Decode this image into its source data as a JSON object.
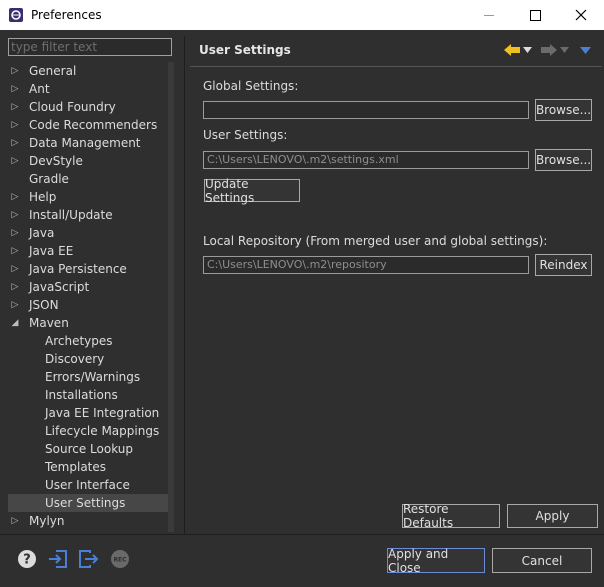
{
  "window": {
    "title": "Preferences"
  },
  "filter": {
    "placeholder": "type filter text"
  },
  "tree": {
    "items": [
      {
        "label": "General",
        "expandable": true
      },
      {
        "label": "Ant",
        "expandable": true
      },
      {
        "label": "Cloud Foundry",
        "expandable": true
      },
      {
        "label": "Code Recommenders",
        "expandable": true
      },
      {
        "label": "Data Management",
        "expandable": true
      },
      {
        "label": "DevStyle",
        "expandable": true
      },
      {
        "label": "Gradle",
        "expandable": false
      },
      {
        "label": "Help",
        "expandable": true
      },
      {
        "label": "Install/Update",
        "expandable": true
      },
      {
        "label": "Java",
        "expandable": true
      },
      {
        "label": "Java EE",
        "expandable": true
      },
      {
        "label": "Java Persistence",
        "expandable": true
      },
      {
        "label": "JavaScript",
        "expandable": true
      },
      {
        "label": "JSON",
        "expandable": true
      },
      {
        "label": "Maven",
        "expandable": true,
        "expanded": true
      },
      {
        "label": "Archetypes",
        "child": true
      },
      {
        "label": "Discovery",
        "child": true
      },
      {
        "label": "Errors/Warnings",
        "child": true
      },
      {
        "label": "Installations",
        "child": true
      },
      {
        "label": "Java EE Integration",
        "child": true
      },
      {
        "label": "Lifecycle Mappings",
        "child": true
      },
      {
        "label": "Source Lookup",
        "child": true
      },
      {
        "label": "Templates",
        "child": true
      },
      {
        "label": "User Interface",
        "child": true
      },
      {
        "label": "User Settings",
        "child": true,
        "selected": true
      },
      {
        "label": "Mylyn",
        "expandable": true
      }
    ]
  },
  "page": {
    "title": "User Settings",
    "global_settings_label": "Global Settings:",
    "global_settings_value": "",
    "user_settings_label": "User Settings:",
    "user_settings_value": "C:\\Users\\LENOVO\\.m2\\settings.xml",
    "browse_label": "Browse...",
    "update_settings_label": "Update Settings",
    "local_repo_label": "Local Repository (From merged user and global settings):",
    "local_repo_value": "C:\\Users\\LENOVO\\.m2\\repository",
    "reindex_label": "Reindex",
    "restore_defaults_label": "Restore Defaults",
    "apply_label": "Apply"
  },
  "footer": {
    "apply_close_label": "Apply and Close",
    "cancel_label": "Cancel"
  },
  "colors": {
    "accent": "#4a7fd6",
    "back_arrow": "#f0c020"
  }
}
